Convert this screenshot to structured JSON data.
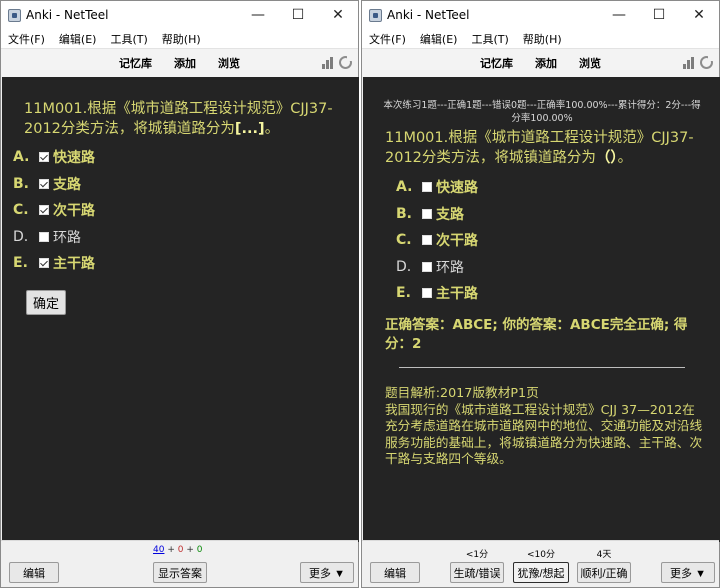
{
  "window": {
    "title": "Anki - NetTeel",
    "minimize": "—",
    "maximize": "☐",
    "close": "✕"
  },
  "menu": [
    "文件(F)",
    "编辑(E)",
    "工具(T)",
    "帮助(H)"
  ],
  "toolbar": [
    "记忆库",
    "添加",
    "浏览"
  ],
  "question": {
    "prefix": "11M001.根据《城市道路工程设计规范》CJJ37-2012分类方法，将城镇道路分为",
    "blank_left": "[...]",
    "end_left": "。",
    "blank_right": "（）",
    "end_right": "。"
  },
  "options": [
    {
      "letter": "A.",
      "text": "快速路",
      "correct": true
    },
    {
      "letter": "B.",
      "text": "支路",
      "correct": true
    },
    {
      "letter": "C.",
      "text": "次干路",
      "correct": true
    },
    {
      "letter": "D.",
      "text": "环路",
      "correct": false
    },
    {
      "letter": "E.",
      "text": "主干路",
      "correct": true
    }
  ],
  "left": {
    "confirm_label": "确定",
    "edit_label": "编辑",
    "show_answer_label": "显示答案",
    "more_label": "更多 ▼",
    "count_new": "40",
    "count_learn": "0",
    "count_review": "0",
    "plus": "+"
  },
  "right": {
    "summary": "本次练习1题---正确1题---错误0题---正确率100.00%---累计得分：2分---得分率100.00%",
    "answer_result": "正确答案：ABCE; 你的答案：ABCE完全正确; 得分：2",
    "explanation_title": "题目解析:2017版教材P1页",
    "explanation_body": "我国现行的《城市道路工程设计规范》CJJ 37—2012在充分考虑道路在城市道路网中的地位、交通功能及对沿线服务功能的基础上，将城镇道路分为快速路、主干路、次干路与支路四个等级。",
    "edit_label": "编辑",
    "more_label": "更多 ▼",
    "ease_buttons": [
      {
        "interval": "<1分",
        "label": "生疏/错误"
      },
      {
        "interval": "<10分",
        "label": "犹豫/想起"
      },
      {
        "interval": "4天",
        "label": "顺利/正确"
      }
    ]
  }
}
